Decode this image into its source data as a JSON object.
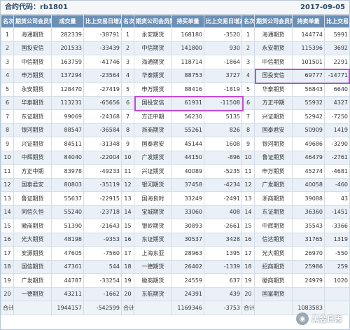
{
  "header": {
    "contract_label": "合约代码：rb1801",
    "date": "2017-09-05"
  },
  "columns": {
    "rank": "名次",
    "member": "期货公司会员简称",
    "vol": "成交量",
    "vol_chg": "比上交易日增减",
    "long": "持买单量",
    "long_chg": "比上交易日增减",
    "short": "持卖单量",
    "short_chg": "比上交易日增减/变化"
  },
  "rows": [
    {
      "r1": "1",
      "n1": "海通期货",
      "v1": "282339",
      "c1": "-38791",
      "r2": "1",
      "n2": "永安期货",
      "v2": "168180",
      "c2": "-3520",
      "r3": "1",
      "n3": "海通期货",
      "v3": "144774",
      "c3": "5991"
    },
    {
      "r1": "2",
      "n1": "国投安信",
      "v1": "201533",
      "c1": "-33439",
      "r2": "2",
      "n2": "中信期货",
      "v2": "141800",
      "c2": "930",
      "r3": "2",
      "n3": "永安期货",
      "v3": "115396",
      "c3": "3692"
    },
    {
      "r1": "3",
      "n1": "中信期货",
      "v1": "163759",
      "c1": "-41746",
      "r2": "3",
      "n2": "海通期货",
      "v2": "118714",
      "c2": "-1864",
      "r3": "3",
      "n3": "中信期货",
      "v3": "101501",
      "c3": "2291"
    },
    {
      "r1": "4",
      "n1": "申万期货",
      "v1": "137294",
      "c1": "-23564",
      "r2": "4",
      "n2": "华泰期货",
      "v2": "88753",
      "c2": "3727",
      "r3": "4",
      "n3": "国投安信",
      "v3": "69777",
      "c3": "-14771"
    },
    {
      "r1": "5",
      "n1": "永安期货",
      "v1": "128470",
      "c1": "-27419",
      "r2": "5",
      "n2": "申万期货",
      "v2": "88416",
      "c2": "-1819",
      "r3": "5",
      "n3": "华泰期货",
      "v3": "56843",
      "c3": "6640"
    },
    {
      "r1": "6",
      "n1": "华泰期货",
      "v1": "113231",
      "c1": "-65656",
      "r2": "6",
      "n2": "国投安信",
      "v2": "61931",
      "c2": "-11508",
      "r3": "6",
      "n3": "方正中期",
      "v3": "55932",
      "c3": "4327"
    },
    {
      "r1": "7",
      "n1": "东证期货",
      "v1": "99069",
      "c1": "-24368",
      "r2": "7",
      "n2": "方正中期",
      "v2": "56230",
      "c2": "5135",
      "r3": "7",
      "n3": "兴证期货",
      "v3": "52942",
      "c3": "-7250"
    },
    {
      "r1": "8",
      "n1": "银河期货",
      "v1": "88547",
      "c1": "-36584",
      "r2": "8",
      "n2": "浙商期货",
      "v2": "55261",
      "c2": "826",
      "r3": "8",
      "n3": "国泰君安",
      "v3": "50909",
      "c3": "1419"
    },
    {
      "r1": "9",
      "n1": "兴证期货",
      "v1": "84511",
      "c1": "-31348",
      "r2": "9",
      "n2": "国泰君安",
      "v2": "45144",
      "c2": "1608",
      "r3": "9",
      "n3": "银河期货",
      "v3": "49686",
      "c3": "-3290"
    },
    {
      "r1": "10",
      "n1": "中辉期货",
      "v1": "84040",
      "c1": "-22004",
      "r2": "10",
      "n2": "广发期货",
      "v2": "44150",
      "c2": "-896",
      "r3": "10",
      "n3": "鲁证期货",
      "v3": "46479",
      "c3": "-2761"
    },
    {
      "r1": "11",
      "n1": "方正中期",
      "v1": "83978",
      "c1": "-49233",
      "r2": "11",
      "n2": "兴证期货",
      "v2": "40089",
      "c2": "-5235",
      "r3": "11",
      "n3": "申万期货",
      "v3": "45274",
      "c3": "-4681"
    },
    {
      "r1": "12",
      "n1": "国泰君安",
      "v1": "80803",
      "c1": "-35119",
      "r2": "12",
      "n2": "银河期货",
      "v2": "37458",
      "c2": "-4234",
      "r3": "12",
      "n3": "广发期货",
      "v3": "40058",
      "c3": "-460"
    },
    {
      "r1": "13",
      "n1": "鲁证期货",
      "v1": "55637",
      "c1": "-22915",
      "r2": "13",
      "n2": "国海良时",
      "v2": "33249",
      "c2": "-2491",
      "r3": "13",
      "n3": "浙商期货",
      "v3": "39088",
      "c3": "43"
    },
    {
      "r1": "14",
      "n1": "同信久恒",
      "v1": "55240",
      "c1": "-23718",
      "r2": "14",
      "n2": "宝城期货",
      "v2": "33060",
      "c2": "408",
      "r3": "14",
      "n3": "东证期货",
      "v3": "36360",
      "c3": "-1451"
    },
    {
      "r1": "15",
      "n1": "徽商期货",
      "v1": "51390",
      "c1": "-21643",
      "r2": "15",
      "n2": "银岭期货",
      "v2": "30893",
      "c2": "-2661",
      "r3": "15",
      "n3": "中辉期货",
      "v3": "35543",
      "c3": "-3366"
    },
    {
      "r1": "16",
      "n1": "光大期货",
      "v1": "48198",
      "c1": "-9353",
      "r2": "16",
      "n2": "东证期货",
      "v2": "30537",
      "c2": "3428",
      "r3": "16",
      "n3": "信达期货",
      "v3": "31765",
      "c3": "1319"
    },
    {
      "r1": "17",
      "n1": "安源期货",
      "v1": "47605",
      "c1": "-7560",
      "r2": "17",
      "n2": "上海东亚",
      "v2": "28963",
      "c2": "1395",
      "r3": "17",
      "n3": "光大期货",
      "v3": "26970",
      "c3": "-550"
    },
    {
      "r1": "18",
      "n1": "国信期货",
      "v1": "47361",
      "c1": "544",
      "r2": "18",
      "n2": "一德期货",
      "v2": "26402",
      "c2": "-1339",
      "r3": "18",
      "n3": "招商期货",
      "v3": "25986",
      "c3": "259"
    },
    {
      "r1": "19",
      "n1": "广发期货",
      "v1": "44787",
      "c1": "-33254",
      "r2": "19",
      "n2": "徽商期货",
      "v2": "24559",
      "c2": "637",
      "r3": "19",
      "n3": "徽商期货",
      "v3": "24979",
      "c3": "1020"
    },
    {
      "r1": "20",
      "n1": "一德期货",
      "v1": "43211",
      "c1": "-1662",
      "r2": "20",
      "n2": "东航期货",
      "v2": "24391",
      "c2": "439",
      "r3": "20",
      "n3": "国富期货",
      "v3": "",
      "c3": ""
    }
  ],
  "totals": {
    "label": "合计",
    "vol": "1944157",
    "vol_chg": "-542599",
    "long": "1169346",
    "long_chg": "-3753",
    "short": "1083583",
    "short_chg": ""
  },
  "watermark": {
    "text": "黑金日志"
  },
  "colors": {
    "header_bg": "#6b8fb5",
    "alt_row": "#e9f0f7",
    "highlight": "#c24dd6"
  }
}
